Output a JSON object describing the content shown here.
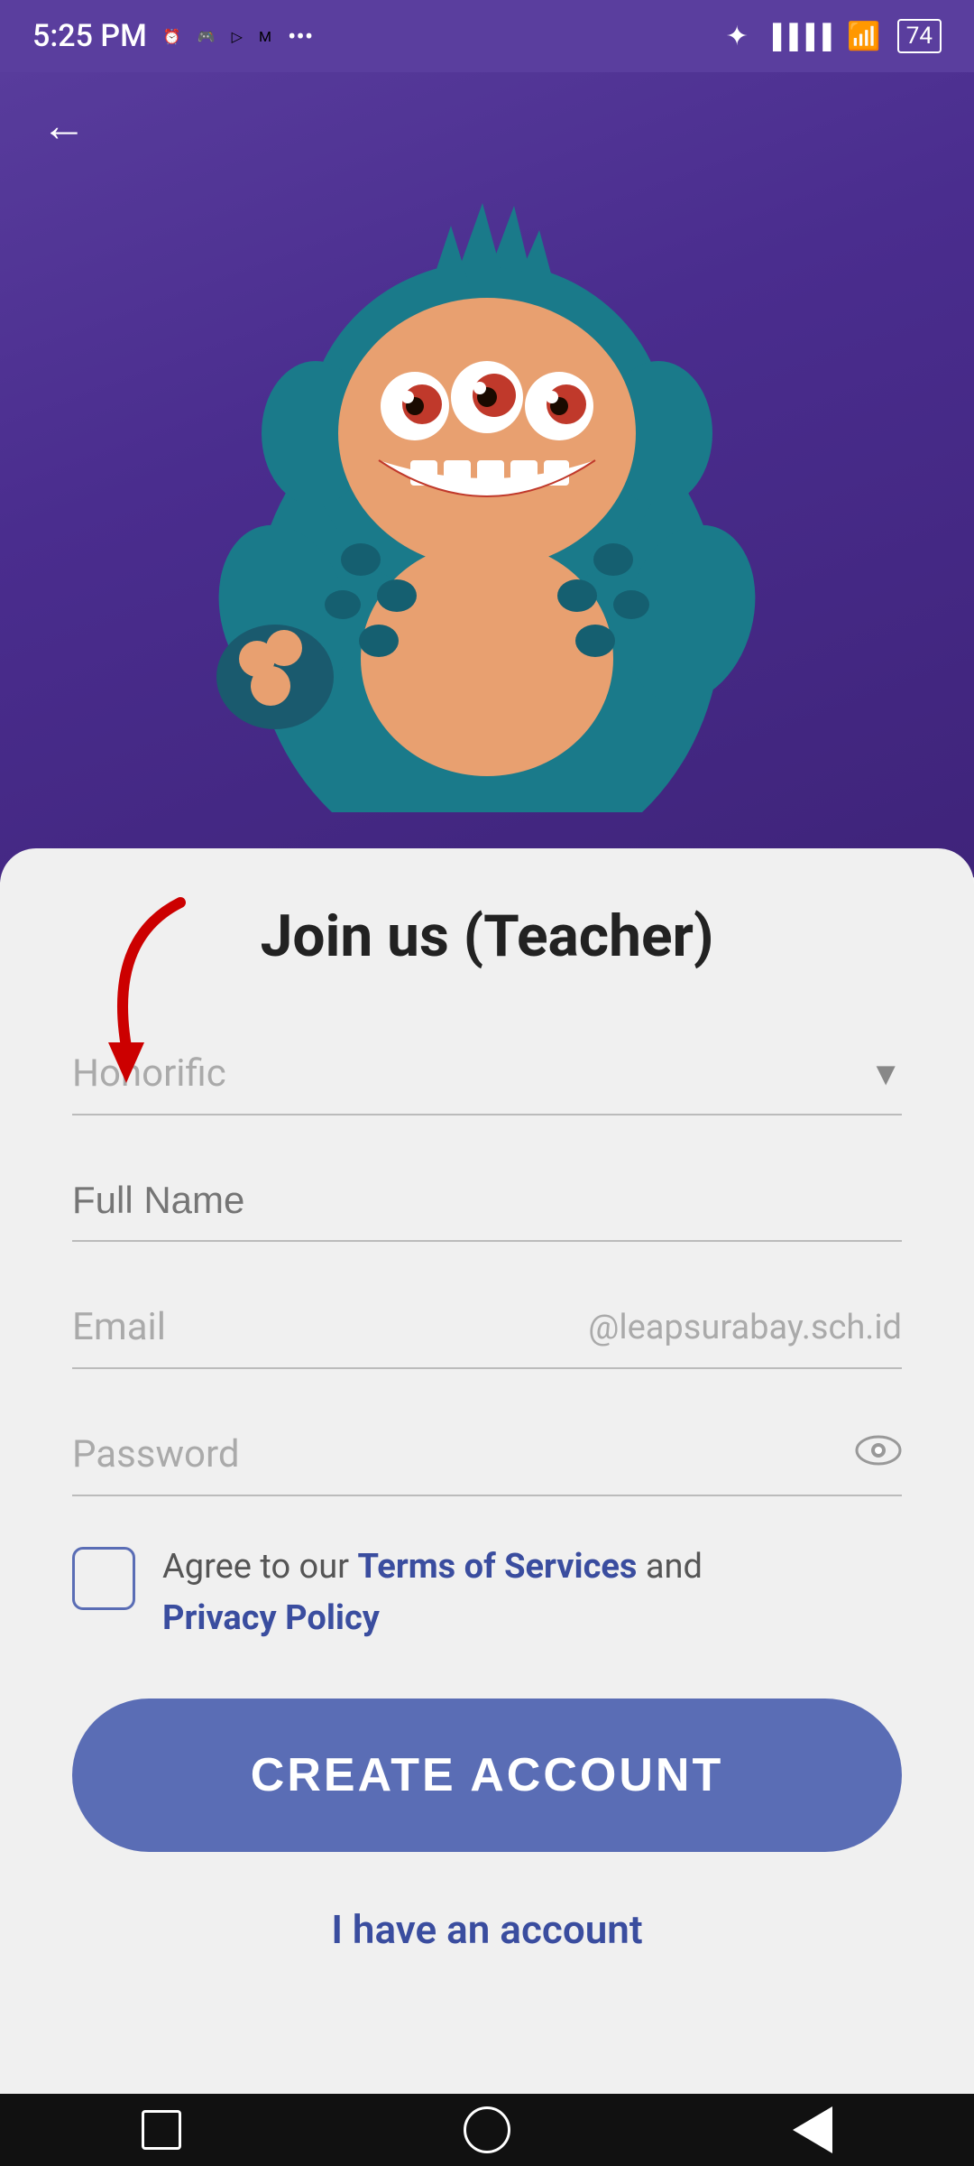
{
  "statusBar": {
    "time": "5:25 PM",
    "batteryLevel": "74"
  },
  "header": {
    "backLabel": "←"
  },
  "form": {
    "title": "Join us (Teacher)",
    "honorificLabel": "Honorific",
    "fullNameLabel": "Full Name",
    "emailLabel": "Email",
    "emailSuffix": "@leapsurabay.sch.id",
    "passwordLabel": "Password",
    "checkboxText": "Agree to our ",
    "termsLink": "Terms of Services",
    "andText": " and ",
    "privacyLink": "Privacy Policy",
    "createAccountBtn": "CREATE ACCOUNT",
    "haveAccountLink": "I have an account"
  }
}
